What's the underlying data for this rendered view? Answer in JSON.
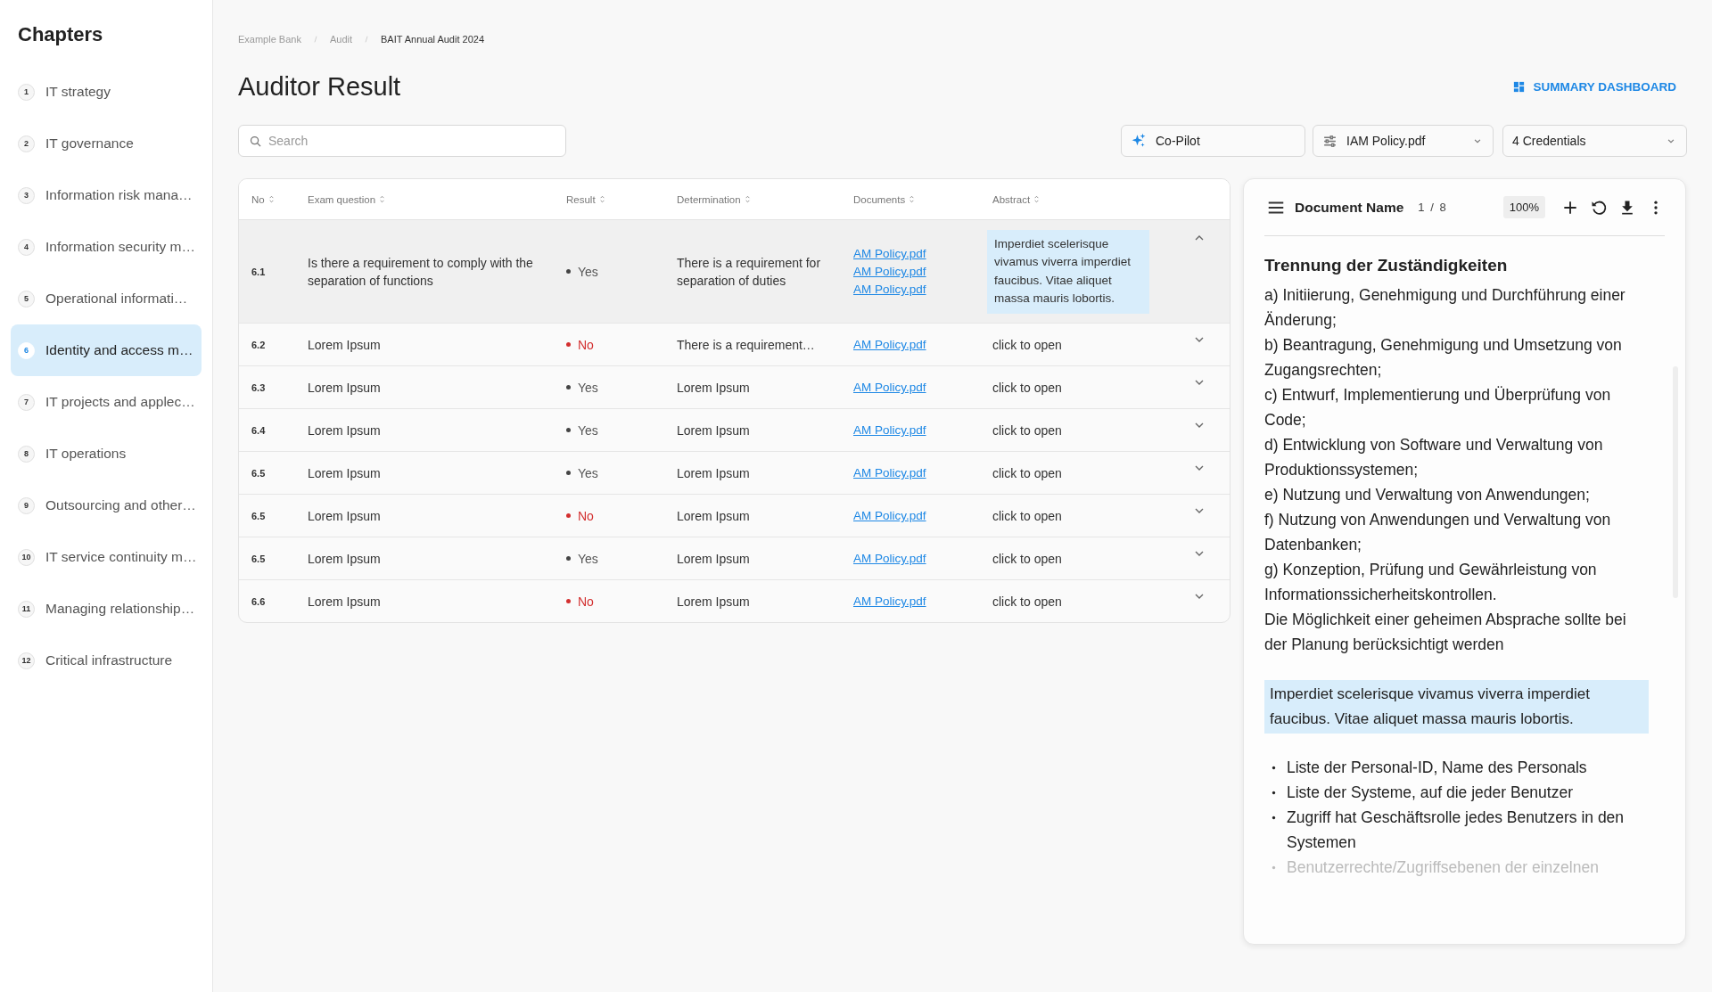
{
  "sidebar": {
    "title": "Chapters",
    "items": [
      {
        "number": "1",
        "label": "IT strategy",
        "selected": false
      },
      {
        "number": "2",
        "label": "IT governance",
        "selected": false
      },
      {
        "number": "3",
        "label": "Information risk mana…",
        "selected": false
      },
      {
        "number": "4",
        "label": "Information security m…",
        "selected": false
      },
      {
        "number": "5",
        "label": "Operational informati…",
        "selected": false
      },
      {
        "number": "6",
        "label": "Identity and access m…",
        "selected": true
      },
      {
        "number": "7",
        "label": "IT projects and applec…",
        "selected": false
      },
      {
        "number": "8",
        "label": "IT operations",
        "selected": false
      },
      {
        "number": "9",
        "label": "Outsourcing and other…",
        "selected": false
      },
      {
        "number": "10",
        "label": "IT service continuity m…",
        "selected": false
      },
      {
        "number": "11",
        "label": "Managing relationship…",
        "selected": false
      },
      {
        "number": "12",
        "label": "Critical infrastructure",
        "selected": false
      }
    ]
  },
  "breadcrumb": [
    "Example Bank",
    "Audit",
    "BAIT Annual Audit 2024"
  ],
  "page_title": "Auditor Result",
  "summary_button": "SUMMARY DASHBOARD",
  "search": {
    "placeholder": "Search"
  },
  "copilot_button": "Co-Pilot",
  "document_select": {
    "value": "IAM Policy.pdf"
  },
  "credentials_select": {
    "value": "4 Credentials"
  },
  "table": {
    "columns": [
      "No",
      "Exam question",
      "Result",
      "Determination",
      "Documents",
      "Abstract"
    ],
    "rows": [
      {
        "no": "6.1",
        "question": "Is there a requirement to comply with the separation of functions",
        "result": "Yes",
        "color": "#444444",
        "determination": "There is a requirement for separation of duties",
        "documents": [
          "AM Policy.pdf",
          "AM Policy.pdf",
          "AM Policy.pdf"
        ],
        "abstract": "Imperdiet scelerisque vivamus viverra imperdiet faucibus. Vitae aliquet massa mauris lobortis.",
        "expanded": true
      },
      {
        "no": "6.2",
        "question": "Lorem Ipsum",
        "result": "No",
        "color": "#d32f2f",
        "determination": "There is a requirement…",
        "documents": [
          "AM Policy.pdf"
        ],
        "abstract": "click to open",
        "expanded": false
      },
      {
        "no": "6.3",
        "question": "Lorem Ipsum",
        "result": "Yes",
        "color": "#444444",
        "determination": "Lorem Ipsum",
        "documents": [
          "AM Policy.pdf"
        ],
        "abstract": "click to open",
        "expanded": false
      },
      {
        "no": "6.4",
        "question": "Lorem Ipsum",
        "result": "Yes",
        "color": "#444444",
        "determination": "Lorem Ipsum",
        "documents": [
          "AM Policy.pdf"
        ],
        "abstract": "click to open",
        "expanded": false
      },
      {
        "no": "6.5",
        "question": "Lorem Ipsum",
        "result": "Yes",
        "color": "#444444",
        "determination": "Lorem Ipsum",
        "documents": [
          "AM Policy.pdf"
        ],
        "abstract": "click to open",
        "expanded": false
      },
      {
        "no": "6.5",
        "question": "Lorem Ipsum",
        "result": "No",
        "color": "#d32f2f",
        "determination": "Lorem Ipsum",
        "documents": [
          "AM Policy.pdf"
        ],
        "abstract": "click to open",
        "expanded": false
      },
      {
        "no": "6.5",
        "question": "Lorem Ipsum",
        "result": "Yes",
        "color": "#444444",
        "determination": "Lorem Ipsum",
        "documents": [
          "AM Policy.pdf"
        ],
        "abstract": "click to open",
        "expanded": false
      },
      {
        "no": "6.6",
        "question": "Lorem Ipsum",
        "result": "No",
        "color": "#d32f2f",
        "determination": "Lorem Ipsum",
        "documents": [
          "AM Policy.pdf"
        ],
        "abstract": "click to open",
        "expanded": false
      }
    ]
  },
  "document_viewer": {
    "name": "Document Name",
    "page": "1 / 8",
    "zoom": "100%",
    "heading": "Trennung der Zuständigkeiten",
    "paragraphs": [
      "a) Initiierung, Genehmigung und Durchführung einer Änderung;",
      "b) Beantragung, Genehmigung und Umsetzung von Zugangsrechten;",
      "c) Entwurf, Implementierung und Überprüfung von Code;",
      "d) Entwicklung von Software und Verwaltung von Produktionssystemen;",
      "e) Nutzung und Verwaltung von Anwendungen;",
      "f) Nutzung von Anwendungen und Verwaltung von Datenbanken;",
      "g) Konzeption, Prüfung und Gewährleistung von Informationssicherheitskontrollen.",
      "Die Möglichkeit einer geheimen Absprache sollte bei der Planung berücksichtigt werden"
    ],
    "highlight": "Imperdiet scelerisque vivamus viverra imperdiet faucibus. Vitae aliquet massa mauris lobortis.",
    "bullets": [
      "Liste der Personal-ID, Name des Personals",
      "Liste der Systeme, auf die jeder Benutzer",
      "Zugriff hat Geschäftsrolle jedes Benutzers in den Systemen",
      "Benutzerrechte/Zugriffsebenen der einzelnen"
    ]
  }
}
